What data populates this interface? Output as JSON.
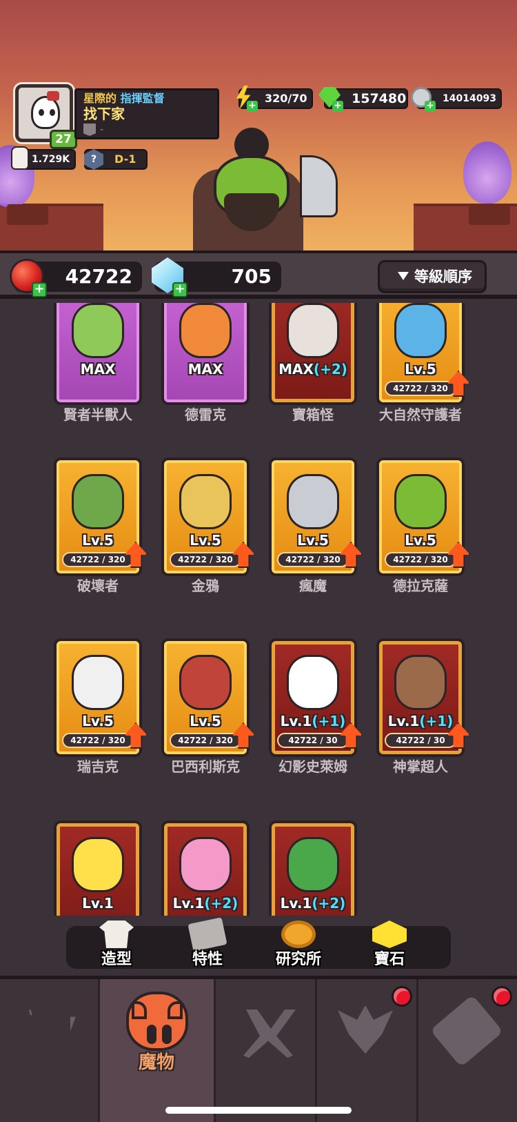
{
  "profile": {
    "title_prefix": "星際的",
    "title_role": "指揮監督",
    "name": "找下家",
    "guild": "-",
    "level": "27",
    "likes": "1.729K",
    "rank_icon": "?",
    "rank": "D-1"
  },
  "resources": {
    "energy": "320/70",
    "gems": "157480",
    "coins": "14014093",
    "red_orb": "42722",
    "crystal": "705"
  },
  "sort_label": "等級順序",
  "monsters": [
    {
      "name": "賢者半獸人",
      "level": "MAX",
      "level_plus": "",
      "progress": "",
      "frame": "purple"
    },
    {
      "name": "德雷克",
      "level": "MAX",
      "level_plus": "",
      "progress": "",
      "frame": "purple"
    },
    {
      "name": "寶箱怪",
      "level": "MAX",
      "level_plus": "(+2)",
      "progress": "",
      "frame": "red"
    },
    {
      "name": "大自然守護者",
      "level": "Lv.5",
      "level_plus": "",
      "progress": "42722 / 320",
      "frame": "orange"
    },
    {
      "name": "破壞者",
      "level": "Lv.5",
      "level_plus": "",
      "progress": "42722 / 320",
      "frame": "orange"
    },
    {
      "name": "金鴉",
      "level": "Lv.5",
      "level_plus": "",
      "progress": "42722 / 320",
      "frame": "orange"
    },
    {
      "name": "瘋魔",
      "level": "Lv.5",
      "level_plus": "",
      "progress": "42722 / 320",
      "frame": "orange"
    },
    {
      "name": "德拉克薩",
      "level": "Lv.5",
      "level_plus": "",
      "progress": "42722 / 320",
      "frame": "orange"
    },
    {
      "name": "瑞吉克",
      "level": "Lv.5",
      "level_plus": "",
      "progress": "42722 / 320",
      "frame": "orange"
    },
    {
      "name": "巴西利斯克",
      "level": "Lv.5",
      "level_plus": "",
      "progress": "42722 / 320",
      "frame": "orange"
    },
    {
      "name": "幻影史萊姆",
      "level": "Lv.1",
      "level_plus": "(+1)",
      "progress": "42722 / 30",
      "frame": "red"
    },
    {
      "name": "神掌超人",
      "level": "Lv.1",
      "level_plus": "(+1)",
      "progress": "42722 / 30",
      "frame": "red"
    },
    {
      "name": "",
      "level": "Lv.1",
      "level_plus": "",
      "progress": "",
      "frame": "red"
    },
    {
      "name": "",
      "level": "Lv.1",
      "level_plus": "(+2)",
      "progress": "",
      "frame": "red"
    },
    {
      "name": "",
      "level": "Lv.1",
      "level_plus": "(+2)",
      "progress": "",
      "frame": "red"
    }
  ],
  "sub_tabs": [
    "造型",
    "特性",
    "研究所",
    "寶石"
  ],
  "nav": {
    "active_label": "魔物",
    "items": [
      "shop",
      "monster",
      "battle",
      "rank",
      "ticket"
    ]
  },
  "colors": {
    "accent_orange": "#f06a3c",
    "card_orange": "#f7b230",
    "card_purple": "#c765d4",
    "card_red": "#a12a25",
    "plus_green": "#3ec24a",
    "notification_red": "#e8152b"
  }
}
